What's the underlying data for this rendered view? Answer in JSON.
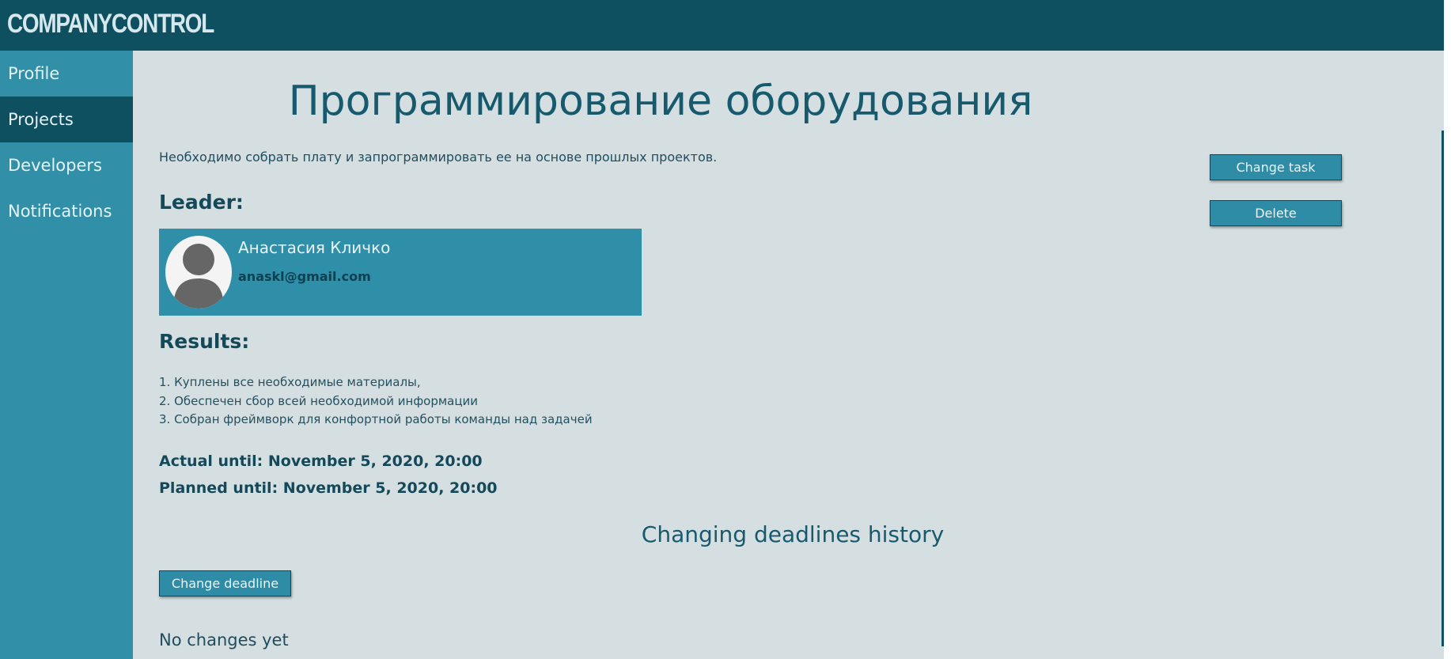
{
  "app": {
    "logo": "COMPANYCONTROL"
  },
  "sidebar": {
    "items": [
      {
        "label": "Profile",
        "active": false
      },
      {
        "label": "Projects",
        "active": true
      },
      {
        "label": "Developers",
        "active": false
      },
      {
        "label": "Notifications",
        "active": false
      }
    ]
  },
  "project": {
    "title": "Программирование оборудования",
    "description": "Необходимо собрать плату и запрограммировать ее на основе прошлых проектов.",
    "buttons": {
      "change_task": "Change task",
      "delete": "Delete"
    },
    "leader_heading": "Leader:",
    "leader": {
      "name": "Анастасия Кличко",
      "email": "anaskl@gmail.com",
      "avatar_icon": "user-silhouette-icon"
    },
    "results_heading": "Results:",
    "results": [
      "1. Куплены все необходимые материалы,",
      "2. Обеспечен сбор всей необходимой информации",
      "3. Собран фреймворк для конфортной работы команды над задачей"
    ],
    "actual_until": "Actual until: November 5, 2020, 20:00",
    "planned_until": "Planned until: November 5, 2020, 20:00",
    "history_title": "Changing deadlines history",
    "change_deadline_button": "Change deadline",
    "no_changes": "No changes yet"
  },
  "colors": {
    "topbar": "#0e4f60",
    "sidebar": "#318fa8",
    "sidebar_active": "#0e4f60",
    "main_bg": "#d5dfe1",
    "button": "#2f8ca6",
    "heading": "#14495a"
  }
}
